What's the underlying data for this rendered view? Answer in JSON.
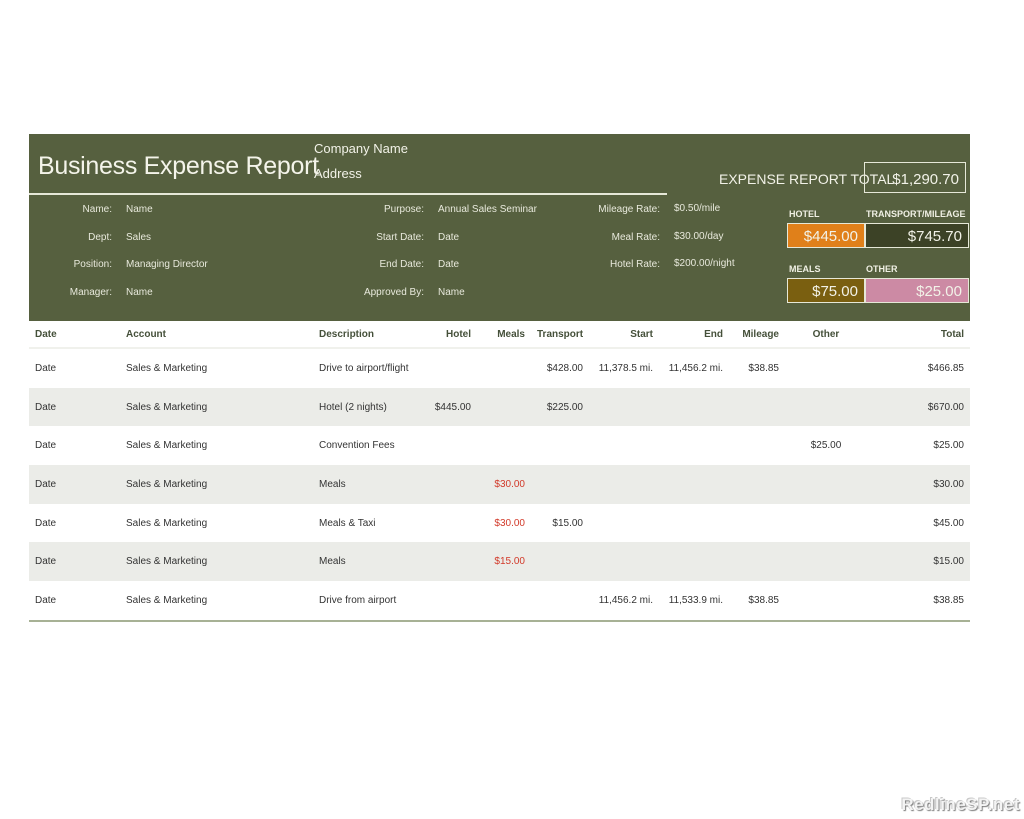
{
  "header": {
    "title": "Business Expense Report",
    "company": "Company Name",
    "address": "Address",
    "total_label": "EXPENSE REPORT TOTAL",
    "total_value": "$1,290.70"
  },
  "employee": [
    {
      "label": "Name:",
      "value": "Name"
    },
    {
      "label": "Dept:",
      "value": "Sales"
    },
    {
      "label": "Position:",
      "value": "Managing Director"
    },
    {
      "label": "Manager:",
      "value": "Name"
    }
  ],
  "trip": [
    {
      "label": "Purpose:",
      "value": "Annual Sales Seminar"
    },
    {
      "label": "Start Date:",
      "value": "Date"
    },
    {
      "label": "End Date:",
      "value": "Date"
    },
    {
      "label": "Approved By:",
      "value": "Name"
    }
  ],
  "rates": [
    {
      "label": "Mileage Rate:",
      "value": "$0.50/mile"
    },
    {
      "label": "Meal Rate:",
      "value": "$30.00/day"
    },
    {
      "label": "Hotel Rate:",
      "value": "$200.00/night"
    }
  ],
  "categories": [
    {
      "label": "HOTEL",
      "value": "$445.00",
      "color": "#e0801a"
    },
    {
      "label": "TRANSPORT/MILEAGE",
      "value": "$745.70",
      "color": "#3c4226"
    },
    {
      "label": "MEALS",
      "value": "$75.00",
      "color": "#7a5f10"
    },
    {
      "label": "OTHER",
      "value": "$25.00",
      "color": "#cc8aa4"
    }
  ],
  "table": {
    "columns": [
      "Date",
      "Account",
      "Description",
      "Hotel",
      "Meals",
      "Transport",
      "Start",
      "End",
      "Mileage",
      "Other",
      "Total"
    ],
    "rows": [
      [
        "Date",
        "Sales & Marketing",
        "Drive to airport/flight",
        "",
        "",
        "$428.00",
        "11,378.5  mi.",
        "11,456.2  mi.",
        "$38.85",
        "",
        "$466.85"
      ],
      [
        "Date",
        "Sales & Marketing",
        "Hotel (2 nights)",
        "$445.00",
        "",
        "$225.00",
        "",
        "",
        "",
        "",
        "$670.00"
      ],
      [
        "Date",
        "Sales & Marketing",
        "Convention Fees",
        "",
        "",
        "",
        "",
        "",
        "",
        "$25.00",
        "$25.00"
      ],
      [
        "Date",
        "Sales & Marketing",
        "Meals",
        "",
        "$30.00",
        "",
        "",
        "",
        "",
        "",
        "$30.00"
      ],
      [
        "Date",
        "Sales & Marketing",
        "Meals & Taxi",
        "",
        "$30.00",
        "$15.00",
        "",
        "",
        "",
        "",
        "$45.00"
      ],
      [
        "Date",
        "Sales & Marketing",
        "Meals",
        "",
        "$15.00",
        "",
        "",
        "",
        "",
        "",
        "$15.00"
      ],
      [
        "Date",
        "Sales & Marketing",
        "Drive from airport",
        "",
        "",
        "",
        "11,456.2  mi.",
        "11,533.9  mi.",
        "$38.85",
        "",
        "$38.85"
      ]
    ]
  },
  "watermark": "RedlineSP.net"
}
